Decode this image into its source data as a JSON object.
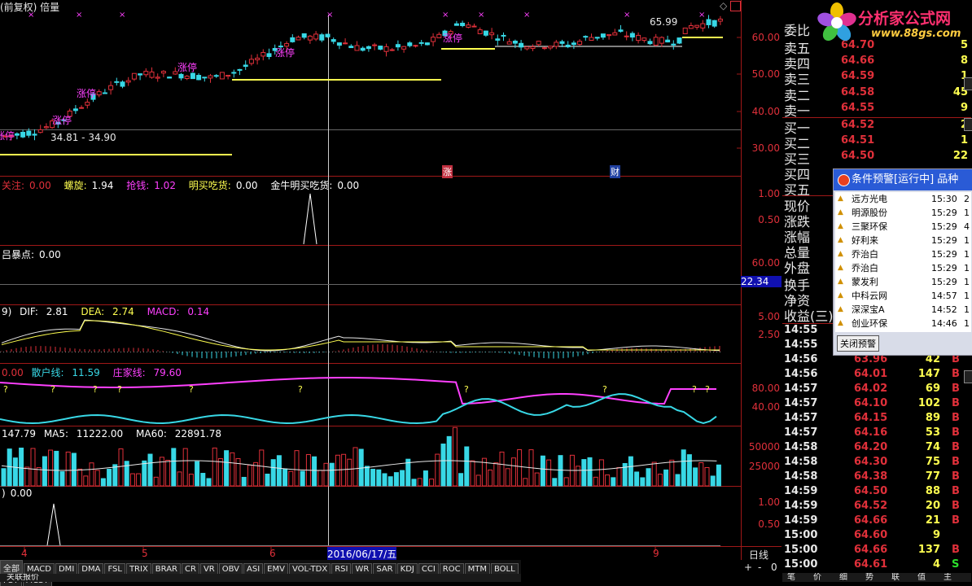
{
  "header": {
    "title": "(前复权) 倍量",
    "mark_star": "◇"
  },
  "main": {
    "price_ticks": [
      "60.00",
      "50.00",
      "40.00",
      "30.00"
    ],
    "price_label_range": "34.81 - 34.90",
    "price_label_high": "65.99",
    "annotations": [
      {
        "text": "涨停"
      },
      {
        "text": "涨停"
      },
      {
        "text": "涨停"
      },
      {
        "text": "涨停"
      },
      {
        "text": "涨停"
      },
      {
        "text": "涨停"
      }
    ],
    "event_badges": [
      "涨",
      "财"
    ]
  },
  "ind1": {
    "items": [
      {
        "label": "关注:",
        "value": "0.00",
        "color": "#e0303a"
      },
      {
        "label": "螺旋:",
        "value": "1.94",
        "color": "#ffff50"
      },
      {
        "label": "抢钱:",
        "value": "1.02",
        "color": "#ff40ff"
      },
      {
        "label": "明买吃货:",
        "value": "0.00",
        "color": "#ffff50"
      },
      {
        "label": "金牛明买吃货:",
        "value": "0.00",
        "color": "#e8e8e8"
      }
    ],
    "ticks": [
      "1.00",
      "0.50"
    ]
  },
  "ind2": {
    "label": "吕暴点:",
    "value": "0.00",
    "ticks": [
      "60.00"
    ],
    "cursor_value": "22.34"
  },
  "macd": {
    "prefix": "9)",
    "items": [
      {
        "label": "DIF:",
        "value": "2.81",
        "color": "#e8e8e8"
      },
      {
        "label": "DEA:",
        "value": "2.74",
        "color": "#ffff50"
      },
      {
        "label": "MACD:",
        "value": "0.14",
        "color": "#ff40ff"
      }
    ],
    "ticks": [
      "5.00",
      "2.50"
    ]
  },
  "retail": {
    "items": [
      {
        "label": "",
        "value": "0.00",
        "color": "#e0303a"
      },
      {
        "label": "散户线:",
        "value": "11.59",
        "color": "#38d8e6"
      },
      {
        "label": "庄家线:",
        "value": "79.60",
        "color": "#ff40ff"
      }
    ],
    "ticks": [
      "80.00",
      "40.00"
    ]
  },
  "volume": {
    "items": [
      {
        "label": "",
        "value": "147.79",
        "color": "#e8e8e8"
      },
      {
        "label": "MA5:",
        "value": "11222.00",
        "color": "#e8e8e8"
      },
      {
        "label": "MA60:",
        "value": "22891.78",
        "color": "#e8e8e8"
      }
    ],
    "ticks": [
      "50000",
      "25000"
    ]
  },
  "ind3": {
    "value": "0.00",
    "ticks": [
      "1.00",
      "0.50"
    ]
  },
  "xaxis": {
    "labels": [
      "4",
      "5",
      "6",
      "9"
    ],
    "cursor_date": "2016/06/17/五",
    "period": "日线",
    "controls": [
      "+",
      "-",
      "0"
    ]
  },
  "tabs": [
    "全部",
    "MACD",
    "DMI",
    "DMA",
    "FSL",
    "TRIX",
    "BRAR",
    "CR",
    "VR",
    "OBV",
    "ASI",
    "EMV",
    "VOL-TDX",
    "RSI",
    "WR",
    "SAR",
    "KDJ",
    "CCI",
    "ROC",
    "MTM",
    "BOLL",
    "PSY",
    "MCST"
  ],
  "bottom_partial": "关联报价",
  "side": {
    "wei_bi": "委比",
    "asks": [
      {
        "name": "卖五",
        "price": "64.70",
        "vol": "5"
      },
      {
        "name": "卖四",
        "price": "64.66",
        "vol": "8"
      },
      {
        "name": "卖三",
        "price": "64.59",
        "vol": "1"
      },
      {
        "name": "卖二",
        "price": "64.58",
        "vol": "45"
      },
      {
        "name": "卖一",
        "price": "64.55",
        "vol": "9"
      }
    ],
    "bids": [
      {
        "name": "买一",
        "price": "64.52",
        "vol": "2"
      },
      {
        "name": "买二",
        "price": "64.51",
        "vol": "1"
      },
      {
        "name": "买三",
        "price": "64.50",
        "vol": "22"
      },
      {
        "name": "买四",
        "price": "",
        "vol": ""
      },
      {
        "name": "买五",
        "price": "",
        "vol": ""
      }
    ],
    "stats": [
      "现价",
      "涨跌",
      "涨幅",
      "总量",
      "外盘",
      "换手",
      "净资",
      "收益(三)"
    ],
    "ticks": [
      {
        "time": "14:55",
        "price": "",
        "vol": "",
        "bs": "",
        "bscolor": "#e0303a"
      },
      {
        "time": "14:55",
        "price": "",
        "vol": "",
        "bs": "",
        "bscolor": "#e0303a"
      },
      {
        "time": "14:56",
        "price": "63.96",
        "vol": "42",
        "bs": "B",
        "bscolor": "#e0303a"
      },
      {
        "time": "14:56",
        "price": "64.01",
        "vol": "147",
        "bs": "B",
        "bscolor": "#e0303a"
      },
      {
        "time": "14:57",
        "price": "64.02",
        "vol": "69",
        "bs": "B",
        "bscolor": "#e0303a"
      },
      {
        "time": "14:57",
        "price": "64.10",
        "vol": "102",
        "bs": "B",
        "bscolor": "#e0303a"
      },
      {
        "time": "14:57",
        "price": "64.15",
        "vol": "89",
        "bs": "B",
        "bscolor": "#e0303a"
      },
      {
        "time": "14:57",
        "price": "64.16",
        "vol": "53",
        "bs": "B",
        "bscolor": "#e0303a"
      },
      {
        "time": "14:58",
        "price": "64.20",
        "vol": "74",
        "bs": "B",
        "bscolor": "#e0303a"
      },
      {
        "time": "14:58",
        "price": "64.30",
        "vol": "75",
        "bs": "B",
        "bscolor": "#e0303a"
      },
      {
        "time": "14:58",
        "price": "64.38",
        "vol": "77",
        "bs": "B",
        "bscolor": "#e0303a"
      },
      {
        "time": "14:59",
        "price": "64.50",
        "vol": "88",
        "bs": "B",
        "bscolor": "#e0303a"
      },
      {
        "time": "14:59",
        "price": "64.52",
        "vol": "20",
        "bs": "B",
        "bscolor": "#e0303a"
      },
      {
        "time": "14:59",
        "price": "64.66",
        "vol": "21",
        "bs": "B",
        "bscolor": "#e0303a"
      },
      {
        "time": "15:00",
        "price": "64.60",
        "vol": "9",
        "bs": "",
        "bscolor": "#e0303a"
      },
      {
        "time": "15:00",
        "price": "64.66",
        "vol": "137",
        "bs": "B",
        "bscolor": "#e0303a"
      },
      {
        "time": "15:00",
        "price": "64.61",
        "vol": "4",
        "bs": "S",
        "bscolor": "#2ce02c"
      }
    ],
    "bottom_tabs": [
      "笔",
      "价",
      "细",
      "势",
      "联",
      "值",
      "主"
    ]
  },
  "alert": {
    "title": "条件预警[运行中] 品种",
    "rows": [
      {
        "name": "远方光电",
        "time": "15:30",
        "extra": "2"
      },
      {
        "name": "明源股份",
        "time": "15:29",
        "extra": "1"
      },
      {
        "name": "三聚环保",
        "time": "15:29",
        "extra": "4"
      },
      {
        "name": "好利来",
        "time": "15:29",
        "extra": "1"
      },
      {
        "name": "乔治白",
        "time": "15:29",
        "extra": "1"
      },
      {
        "name": "乔治白",
        "time": "15:29",
        "extra": "1"
      },
      {
        "name": "蒙发利",
        "time": "15:29",
        "extra": "1"
      },
      {
        "name": "中科云网",
        "time": "14:57",
        "extra": "1"
      },
      {
        "name": "深深宝A",
        "time": "14:52",
        "extra": "1"
      },
      {
        "name": "创业环保",
        "time": "14:46",
        "extra": "1"
      }
    ],
    "close_btn": "关闭预警"
  },
  "logo": {
    "line1": "分析家公式网",
    "line2": "www.88gs.com"
  },
  "colors": {
    "up": "#e0303a",
    "down": "#38d8e6",
    "grid": "#a01818",
    "yellow_line": "#ffff50"
  }
}
